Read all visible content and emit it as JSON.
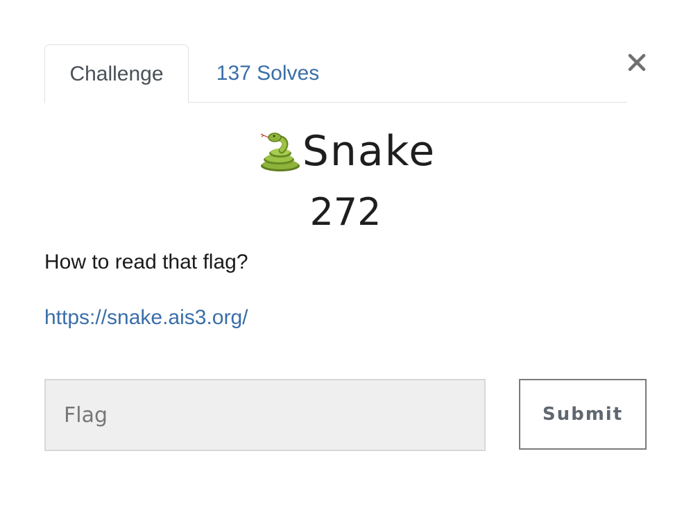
{
  "tabs": {
    "challenge_label": "Challenge",
    "solves_label": "137 Solves"
  },
  "close": {
    "icon": "close-icon",
    "glyph": "×"
  },
  "challenge": {
    "icon": "snake-icon",
    "name": "Snake",
    "points": "272",
    "description": "How to read that flag?",
    "link_text": "https://snake.ais3.org/"
  },
  "form": {
    "flag_placeholder": "Flag",
    "flag_value": "",
    "submit_label": "Submit"
  },
  "colors": {
    "link": "#3a6ea8",
    "input_bg": "#efefef",
    "border": "#dee2e6"
  }
}
